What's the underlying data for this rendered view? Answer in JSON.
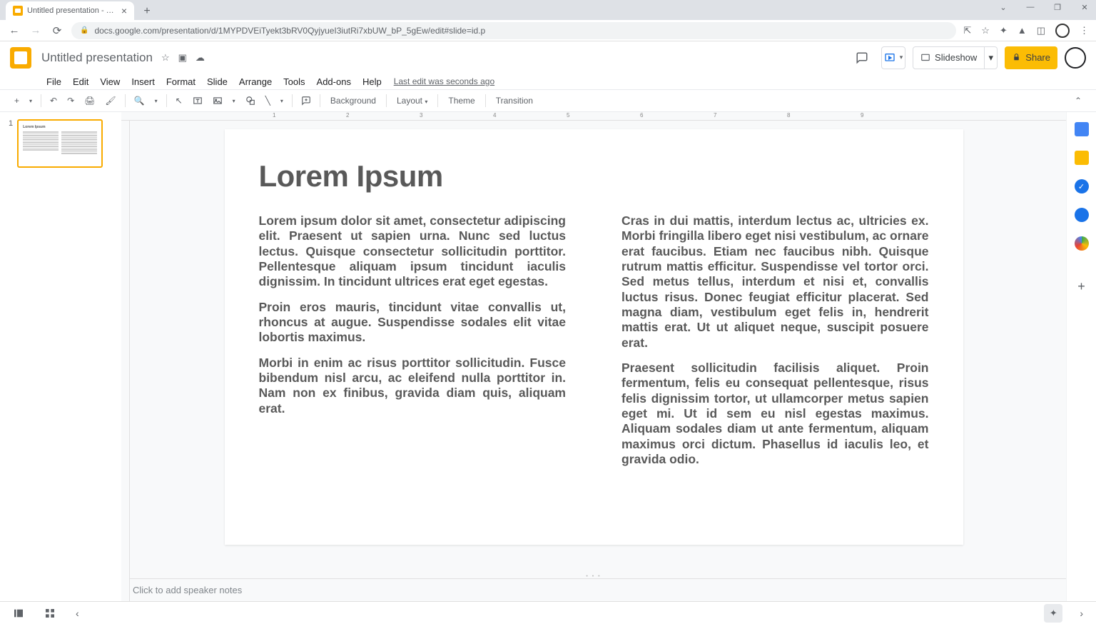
{
  "browser": {
    "tab_title": "Untitled presentation - Google S",
    "url": "docs.google.com/presentation/d/1MYPDVEiTyekt3bRV0QyjyueI3iutRi7xbUW_bP_5gEw/edit#slide=id.p"
  },
  "header": {
    "doc_title": "Untitled presentation",
    "slideshow_label": "Slideshow",
    "share_label": "Share"
  },
  "menu": {
    "items": [
      "File",
      "Edit",
      "View",
      "Insert",
      "Format",
      "Slide",
      "Arrange",
      "Tools",
      "Add-ons",
      "Help"
    ],
    "last_edit": "Last edit was seconds ago"
  },
  "toolbar": {
    "background": "Background",
    "layout": "Layout",
    "theme": "Theme",
    "transition": "Transition"
  },
  "ruler": {
    "marks": [
      "1",
      "2",
      "3",
      "4",
      "5",
      "6",
      "7",
      "8",
      "9"
    ]
  },
  "thumbnails": {
    "items": [
      {
        "number": "1",
        "title": "Lorem Ipsum"
      }
    ]
  },
  "slide": {
    "title": "Lorem Ipsum",
    "left_paragraphs": [
      "Lorem ipsum dolor sit amet, consectetur adipiscing elit. Praesent ut sapien urna. Nunc sed luctus lectus. Quisque consectetur sollicitudin porttitor. Pellentesque aliquam ipsum tincidunt iaculis dignissim. In tincidunt ultrices erat eget egestas.",
      "Proin eros mauris, tincidunt vitae convallis ut, rhoncus at augue. Suspendisse sodales elit vitae lobortis maximus.",
      "Morbi in enim ac risus porttitor sollicitudin. Fusce bibendum nisl arcu, ac eleifend nulla porttitor in. Nam non ex finibus, gravida diam quis, aliquam erat."
    ],
    "right_paragraphs": [
      "Cras in dui mattis, interdum lectus ac, ultricies ex. Morbi fringilla libero eget nisi vestibulum, ac ornare erat faucibus. Etiam nec faucibus nibh. Quisque rutrum mattis efficitur. Suspendisse vel tortor orci. Sed metus tellus, interdum et nisi et, convallis luctus risus. Donec feugiat efficitur placerat. Sed magna diam, vestibulum eget felis in, hendrerit mattis erat. Ut ut aliquet neque, suscipit posuere erat.",
      "Praesent sollicitudin facilisis aliquet. Proin fermentum, felis eu consequat pellentesque, risus felis dignissim tortor, ut ullamcorper metus sapien eget mi. Ut id sem eu nisl egestas maximus. Aliquam sodales diam ut ante fermentum, aliquam maximus orci dictum. Phasellus id iaculis leo, et gravida odio."
    ]
  },
  "notes": {
    "placeholder": "Click to add speaker notes"
  }
}
